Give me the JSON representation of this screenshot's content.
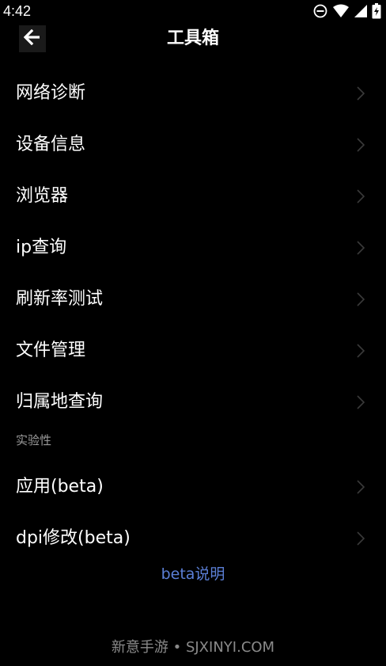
{
  "status_bar": {
    "time": "4:42",
    "icons": [
      "do-not-disturb-icon",
      "wifi-icon",
      "signal-icon",
      "battery-icon"
    ]
  },
  "header": {
    "back_icon": "arrow-left-icon",
    "title": "工具箱"
  },
  "menu": {
    "items": [
      {
        "label": "网络诊断"
      },
      {
        "label": "设备信息"
      },
      {
        "label": "浏览器"
      },
      {
        "label": "ip查询"
      },
      {
        "label": "刷新率测试"
      },
      {
        "label": "文件管理"
      },
      {
        "label": "归属地查询"
      }
    ]
  },
  "experimental": {
    "header": "实验性",
    "items": [
      {
        "label": "应用(beta)"
      },
      {
        "label": "dpi修改(beta)"
      }
    ]
  },
  "beta_link": "beta说明",
  "watermark": "新意手游 • SJXINYI.COM",
  "colors": {
    "background": "#000000",
    "text": "#ffffff",
    "section_header": "#9a9a9a",
    "link": "#5b7fd6",
    "chevron": "#3a3a3a"
  }
}
